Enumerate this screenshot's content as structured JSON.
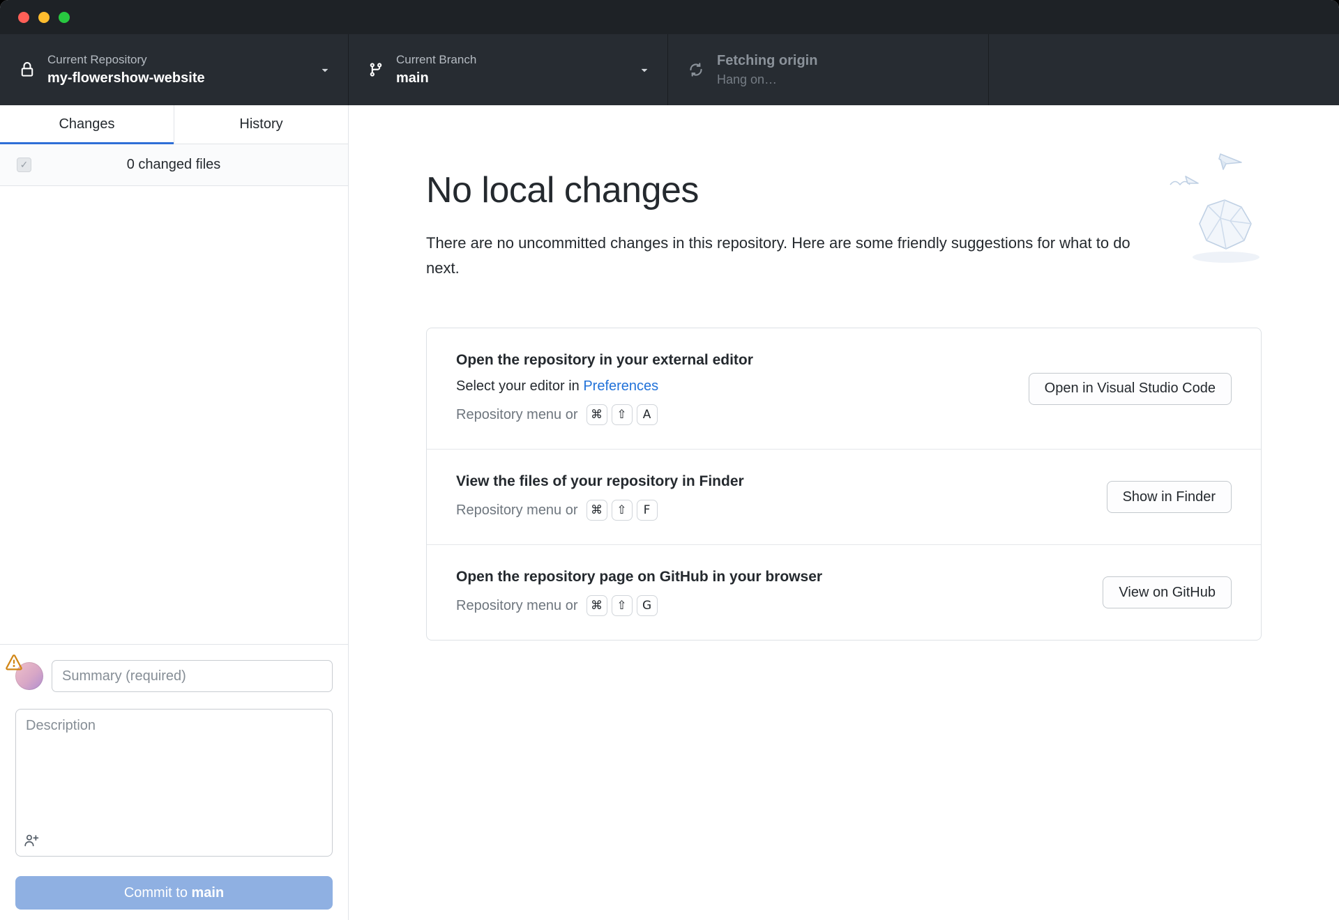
{
  "titlebar": {
    "traffic_lights": [
      "close",
      "minimize",
      "zoom"
    ]
  },
  "toolbar": {
    "repo": {
      "label": "Current Repository",
      "value": "my-flowershow-website"
    },
    "branch": {
      "label": "Current Branch",
      "value": "main"
    },
    "fetch": {
      "label": "Fetching origin",
      "sublabel": "Hang on…"
    }
  },
  "sidebar": {
    "tabs": [
      {
        "label": "Changes",
        "active": true
      },
      {
        "label": "History",
        "active": false
      }
    ],
    "files_summary": "0 changed files",
    "commit": {
      "summary_placeholder": "Summary (required)",
      "description_placeholder": "Description",
      "button_prefix": "Commit to ",
      "button_branch": "main"
    }
  },
  "main": {
    "title": "No local changes",
    "subtitle": "There are no uncommitted changes in this repository. Here are some friendly suggestions for what to do next.",
    "suggestions": [
      {
        "title": "Open the repository in your external editor",
        "line_prefix": "Select your editor in ",
        "link": "Preferences",
        "menu_hint": "Repository menu or",
        "keys": [
          "⌘",
          "⇧",
          "A"
        ],
        "button": "Open in Visual Studio Code"
      },
      {
        "title": "View the files of your repository in Finder",
        "menu_hint": "Repository menu or",
        "keys": [
          "⌘",
          "⇧",
          "F"
        ],
        "button": "Show in Finder"
      },
      {
        "title": "Open the repository page on GitHub in your browser",
        "menu_hint": "Repository menu or",
        "keys": [
          "⌘",
          "⇧",
          "G"
        ],
        "button": "View on GitHub"
      }
    ]
  },
  "colors": {
    "accent_blue": "#2f6fd7",
    "link_blue": "#2172d9",
    "commit_button_blue": "#8fb0e2",
    "warning_orange": "#d18616",
    "toolbar_dark": "#272c32"
  }
}
